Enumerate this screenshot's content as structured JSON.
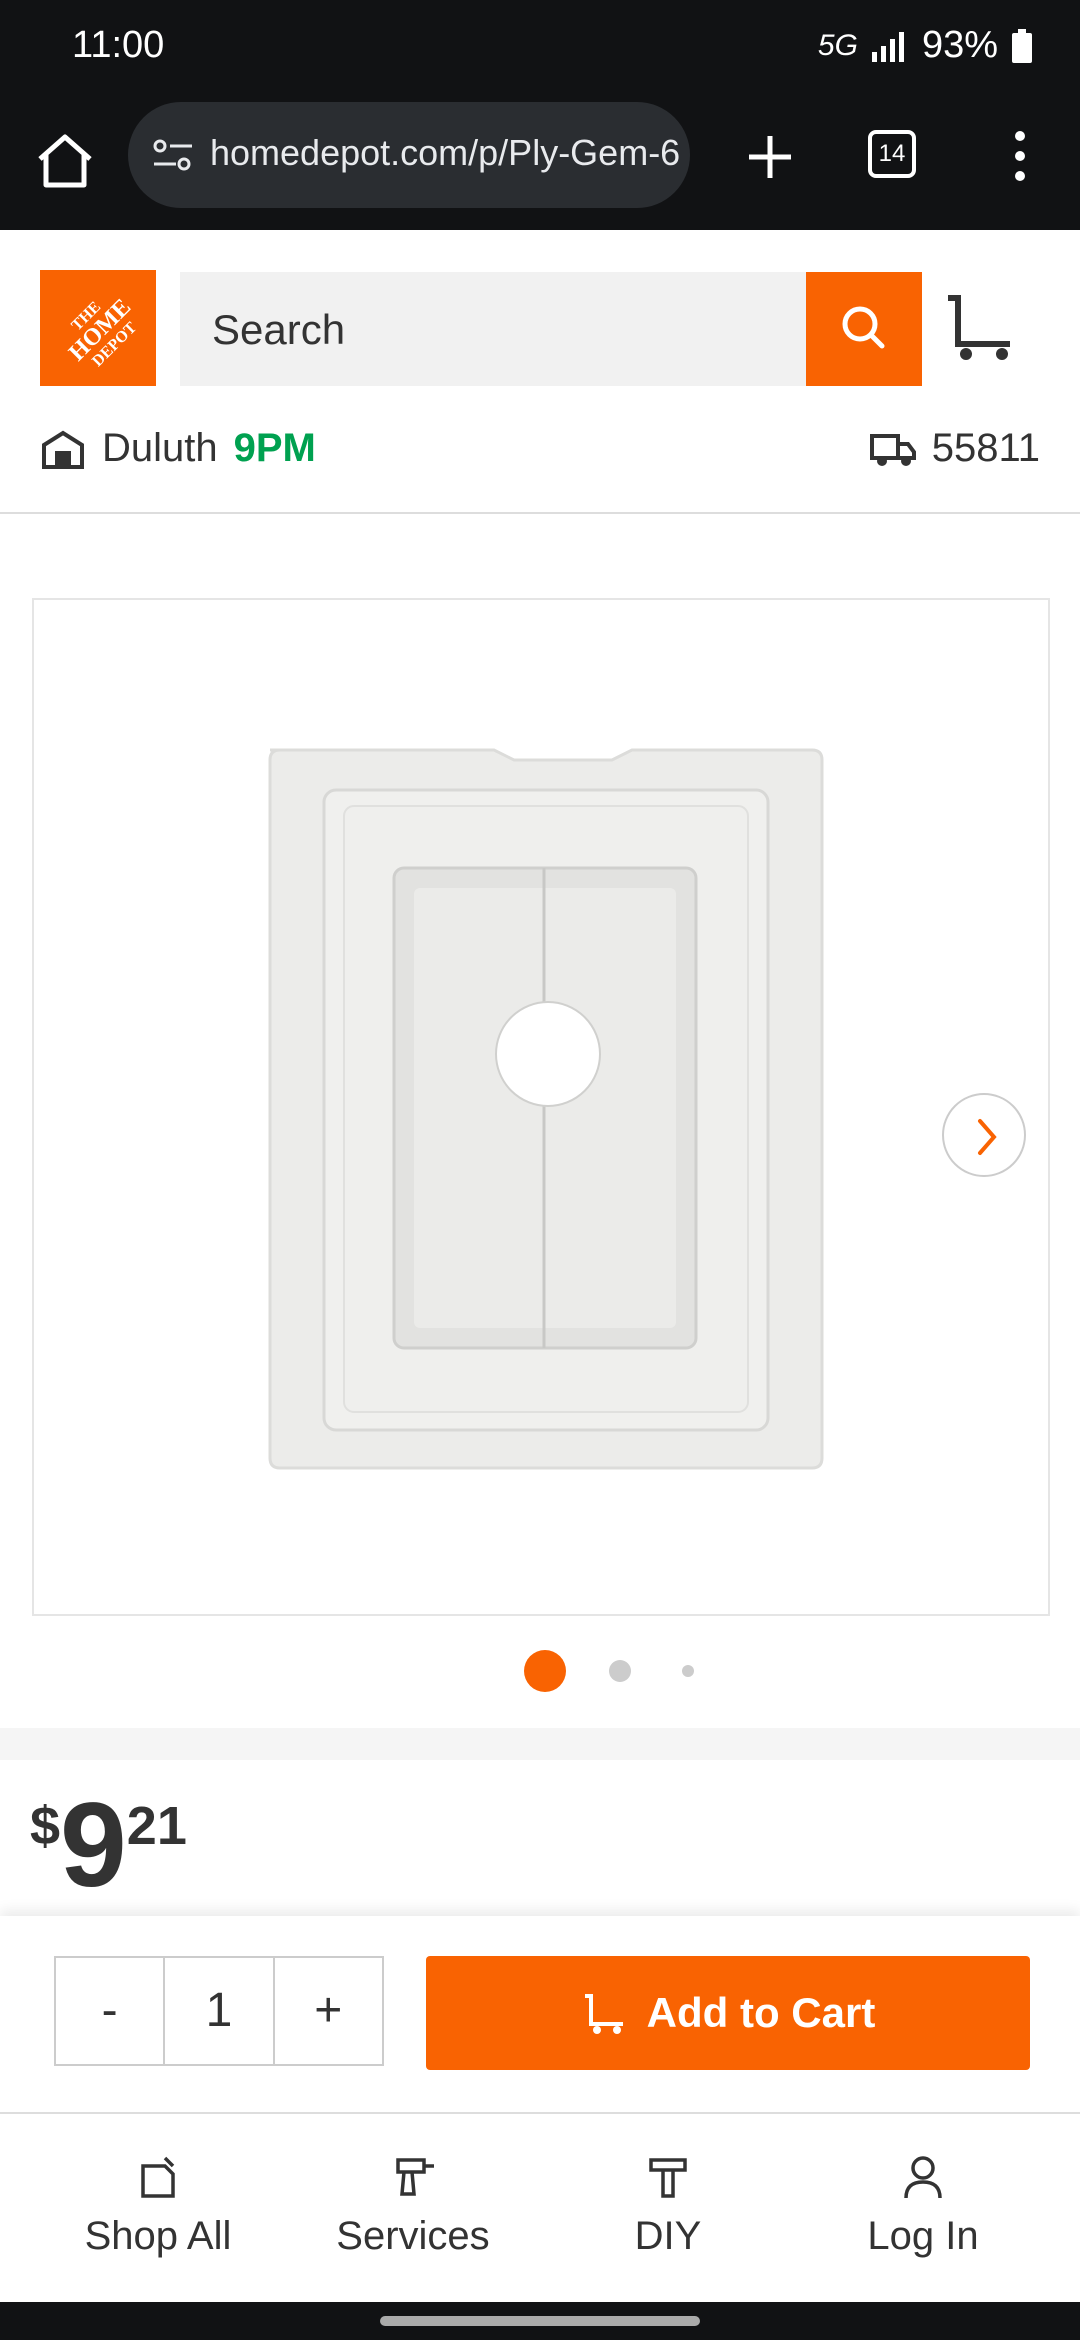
{
  "status_bar": {
    "time": "11:00",
    "battery": "93%",
    "network": "5G"
  },
  "browser": {
    "url": "homedepot.com/p/Ply-Gem-6",
    "tab_count": "14"
  },
  "header": {
    "search_placeholder": "Search",
    "store_name": "Duluth",
    "store_close_time": "9PM",
    "delivery_zip": "55811"
  },
  "product": {
    "image_index": 1,
    "image_count": 3,
    "price": {
      "currency": "$",
      "dollars": "9",
      "cents": "21"
    }
  },
  "buy": {
    "quantity": "1",
    "minus_label": "-",
    "plus_label": "+",
    "add_to_cart_label": "Add to Cart"
  },
  "bottom_nav": {
    "items": [
      {
        "label": "Shop All",
        "icon": "shop-all-icon"
      },
      {
        "label": "Services",
        "icon": "drill-icon"
      },
      {
        "label": "DIY",
        "icon": "hammer-icon"
      },
      {
        "label": "Log In",
        "icon": "person-icon"
      }
    ]
  },
  "colors": {
    "brand": "#f96302",
    "store_time": "#00a150"
  }
}
